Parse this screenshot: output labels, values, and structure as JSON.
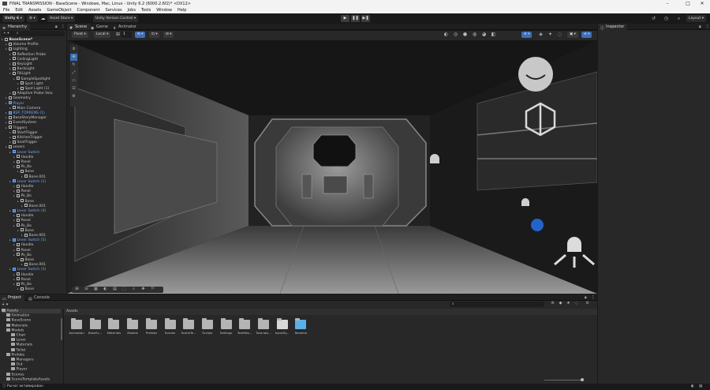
{
  "window": {
    "title": "FINAL TRANSMISSION - BaseScene - Windows, Mac, Linux - Unity 6.2 (6000.2.6f2)* <DX12>"
  },
  "menu": [
    "File",
    "Edit",
    "Assets",
    "GameObject",
    "Component",
    "Services",
    "Jobs",
    "Tools",
    "Window",
    "Help"
  ],
  "toolbar": {
    "account": "Unity 6",
    "asset_store": "Asset Store",
    "version_control": "Unity Version Control",
    "layout": "Layout"
  },
  "hierarchy": {
    "tab": "Hierarchy",
    "items": [
      {
        "label": "BaseScene*",
        "depth": 0,
        "kind": "scene"
      },
      {
        "label": "Volume Profile",
        "depth": 1,
        "kind": "obj"
      },
      {
        "label": "Lighting",
        "depth": 1,
        "kind": "obj"
      },
      {
        "label": "Reflection Probe",
        "depth": 2,
        "kind": "obj"
      },
      {
        "label": "CeilingLight",
        "depth": 2,
        "kind": "obj"
      },
      {
        "label": "KeyLight",
        "depth": 2,
        "kind": "obj"
      },
      {
        "label": "BackLight",
        "depth": 2,
        "kind": "obj"
      },
      {
        "label": "FillLight",
        "depth": 2,
        "kind": "obj"
      },
      {
        "label": "SampleSpotlight",
        "depth": 3,
        "kind": "obj"
      },
      {
        "label": "Spot Light",
        "depth": 4,
        "kind": "obj"
      },
      {
        "label": "Spot Light (1)",
        "depth": 4,
        "kind": "obj"
      },
      {
        "label": "Adaptive Probe Volu",
        "depth": 2,
        "kind": "obj"
      },
      {
        "label": "Geometry",
        "depth": 1,
        "kind": "obj"
      },
      {
        "label": "Player",
        "depth": 1,
        "kind": "prefab"
      },
      {
        "label": "Main Camera",
        "depth": 2,
        "kind": "obj"
      },
      {
        "label": "BSP_TORRENS (1)",
        "depth": 1,
        "kind": "prefab"
      },
      {
        "label": "BaseStoryManager",
        "depth": 1,
        "kind": "obj"
      },
      {
        "label": "EventSystem",
        "depth": 1,
        "kind": "obj"
      },
      {
        "label": "Triggers",
        "depth": 1,
        "kind": "obj"
      },
      {
        "label": "StartTrigger",
        "depth": 2,
        "kind": "obj"
      },
      {
        "label": "KitchenTrigger",
        "depth": 2,
        "kind": "obj"
      },
      {
        "label": "SeatTrigger",
        "depth": 2,
        "kind": "obj"
      },
      {
        "label": "Levers",
        "depth": 1,
        "kind": "obj"
      },
      {
        "label": "Lever Switch",
        "depth": 2,
        "kind": "prefab"
      },
      {
        "label": "Handle",
        "depth": 3,
        "kind": "obj"
      },
      {
        "label": "Panel",
        "depth": 3,
        "kind": "obj"
      },
      {
        "label": "Pk_Bo",
        "depth": 3,
        "kind": "obj"
      },
      {
        "label": "Bone",
        "depth": 4,
        "kind": "obj"
      },
      {
        "label": "Bone.001",
        "depth": 5,
        "kind": "obj"
      },
      {
        "label": "Lever Switch (1)",
        "depth": 2,
        "kind": "prefab"
      },
      {
        "label": "Handle",
        "depth": 3,
        "kind": "obj"
      },
      {
        "label": "Panel",
        "depth": 3,
        "kind": "obj"
      },
      {
        "label": "Pk_Bo",
        "depth": 3,
        "kind": "obj"
      },
      {
        "label": "Bone",
        "depth": 4,
        "kind": "obj"
      },
      {
        "label": "Bone.001",
        "depth": 5,
        "kind": "obj"
      },
      {
        "label": "Lever Switch (4)",
        "depth": 2,
        "kind": "prefab"
      },
      {
        "label": "Handle",
        "depth": 3,
        "kind": "obj"
      },
      {
        "label": "Panel",
        "depth": 3,
        "kind": "obj"
      },
      {
        "label": "Pk_Bo",
        "depth": 3,
        "kind": "obj"
      },
      {
        "label": "Bone",
        "depth": 4,
        "kind": "obj"
      },
      {
        "label": "Bone.001",
        "depth": 5,
        "kind": "obj"
      },
      {
        "label": "Lever Switch (5)",
        "depth": 2,
        "kind": "prefab"
      },
      {
        "label": "Handle",
        "depth": 3,
        "kind": "obj"
      },
      {
        "label": "Panel",
        "depth": 3,
        "kind": "obj"
      },
      {
        "label": "Pk_Bo",
        "depth": 3,
        "kind": "obj"
      },
      {
        "label": "Bone",
        "depth": 4,
        "kind": "obj"
      },
      {
        "label": "Bone.001",
        "depth": 5,
        "kind": "obj"
      },
      {
        "label": "Lever Switch (3)",
        "depth": 2,
        "kind": "prefab"
      },
      {
        "label": "Handle",
        "depth": 3,
        "kind": "obj"
      },
      {
        "label": "Panel",
        "depth": 3,
        "kind": "obj"
      },
      {
        "label": "Pk_Bo",
        "depth": 3,
        "kind": "obj"
      },
      {
        "label": "Bone",
        "depth": 4,
        "kind": "obj"
      }
    ]
  },
  "center_tabs": [
    "Scene",
    "Game",
    "Animator"
  ],
  "scene_toolbar": {
    "pivot": "Pivot",
    "space": "Local",
    "grid_value": "1"
  },
  "inspector": {
    "tab": "Inspector"
  },
  "bottom_tabs": [
    "Project",
    "Console"
  ],
  "project": {
    "tree": [
      {
        "label": "Assets",
        "depth": 0
      },
      {
        "label": "Animation",
        "depth": 1
      },
      {
        "label": "BaseScene",
        "depth": 1
      },
      {
        "label": "Materials",
        "depth": 1
      },
      {
        "label": "Models",
        "depth": 1
      },
      {
        "label": "Chair",
        "depth": 2
      },
      {
        "label": "Lever",
        "depth": 2
      },
      {
        "label": "Materials",
        "depth": 2
      },
      {
        "label": "Toilet",
        "depth": 2
      },
      {
        "label": "Prefabs",
        "depth": 1
      },
      {
        "label": "Managers",
        "depth": 2
      },
      {
        "label": "Out",
        "depth": 2
      },
      {
        "label": "Player",
        "depth": 2
      },
      {
        "label": "Scenes",
        "depth": 1
      },
      {
        "label": "SceneTemplateAssets",
        "depth": 1
      }
    ],
    "breadcrumb": "Assets",
    "assets": [
      "Animation",
      "BaseSc...",
      "Materials",
      "Models",
      "Prefabs",
      "Scenes",
      "SceneTe...",
      "Scripts",
      "Settings",
      "TextMes...",
      "Tutorials...",
      "InputSy...",
      "Readme"
    ]
  },
  "status": {
    "text": "Рычаг активирован"
  },
  "colors": {
    "prefab_blue": "#6fa8ff",
    "accent": "#3d6fb6"
  }
}
